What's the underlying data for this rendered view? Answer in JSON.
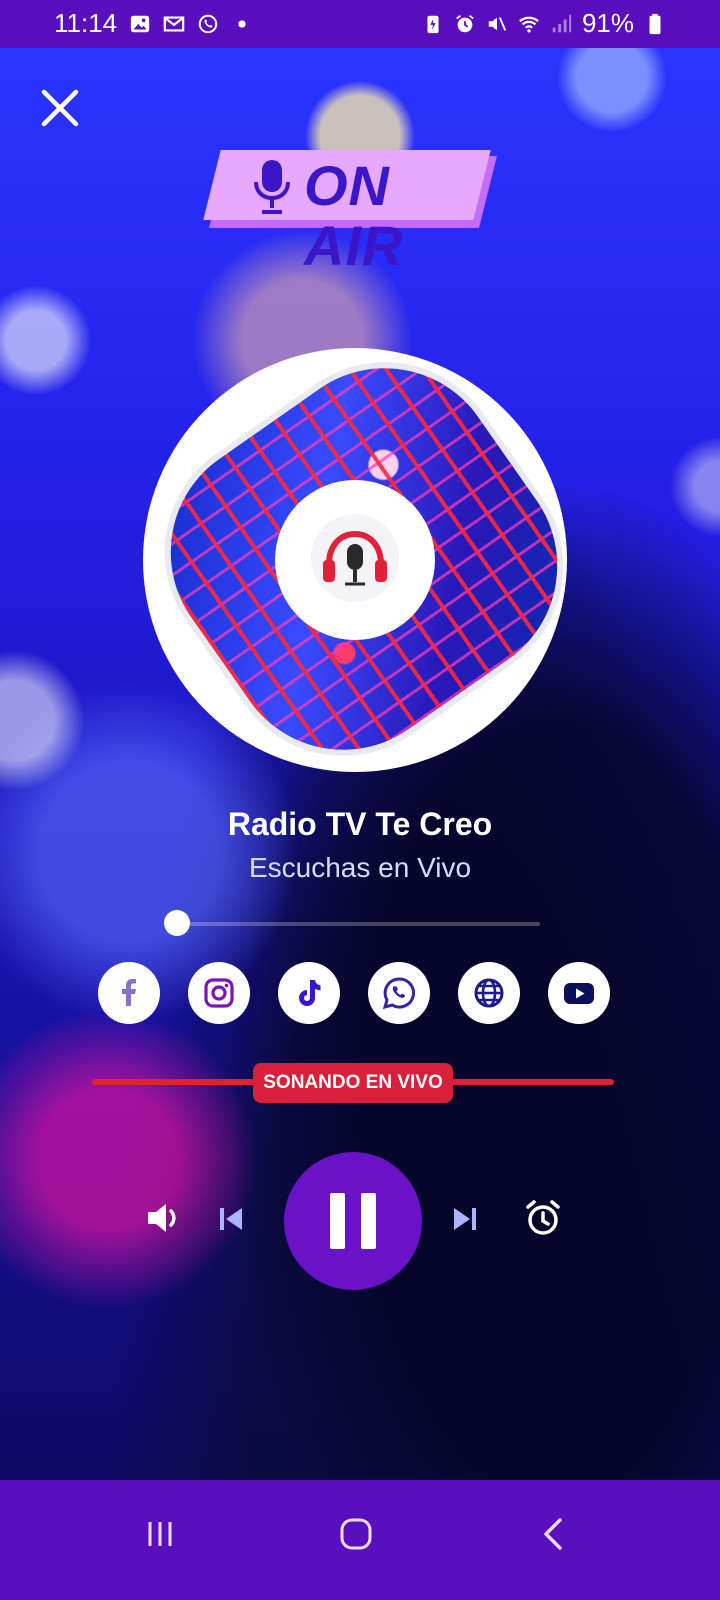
{
  "status_bar": {
    "time": "11:14",
    "battery": "91%",
    "left_icons": [
      "image-icon",
      "gmail-icon",
      "whatsapp-icon",
      "dot-icon"
    ],
    "right_icons": [
      "battery-saver-icon",
      "alarm-icon",
      "mute-icon",
      "wifi-icon",
      "signal-icon",
      "battery-icon"
    ]
  },
  "badge": {
    "text": "ON AIR",
    "icon": "microphone-icon"
  },
  "station": {
    "title": "Radio TV Te Creo",
    "subtitle": "Escuchas en Vivo"
  },
  "progress": {
    "value": 0
  },
  "social": [
    {
      "name": "facebook",
      "icon": "facebook-icon",
      "color": "#8b6fc9"
    },
    {
      "name": "instagram",
      "icon": "instagram-icon",
      "color": "#7a14b8"
    },
    {
      "name": "tiktok",
      "icon": "tiktok-icon",
      "color": "#3b16c9"
    },
    {
      "name": "whatsapp",
      "icon": "whatsapp-icon",
      "color": "#3a1fa8"
    },
    {
      "name": "website",
      "icon": "globe-icon",
      "color": "#1c1a8c"
    },
    {
      "name": "youtube",
      "icon": "youtube-icon",
      "color": "#0c0f5c"
    }
  ],
  "live": {
    "label": "SONANDO EN VIVO",
    "color": "#d9203b"
  },
  "player": {
    "state": "playing",
    "icons": [
      "volume-icon",
      "previous-icon",
      "pause-icon",
      "next-icon",
      "alarm-icon"
    ],
    "accent": "#6a12c6"
  },
  "nav": {
    "icons": [
      "recents-icon",
      "home-icon",
      "back-icon"
    ],
    "color": "#5a0fbf"
  }
}
